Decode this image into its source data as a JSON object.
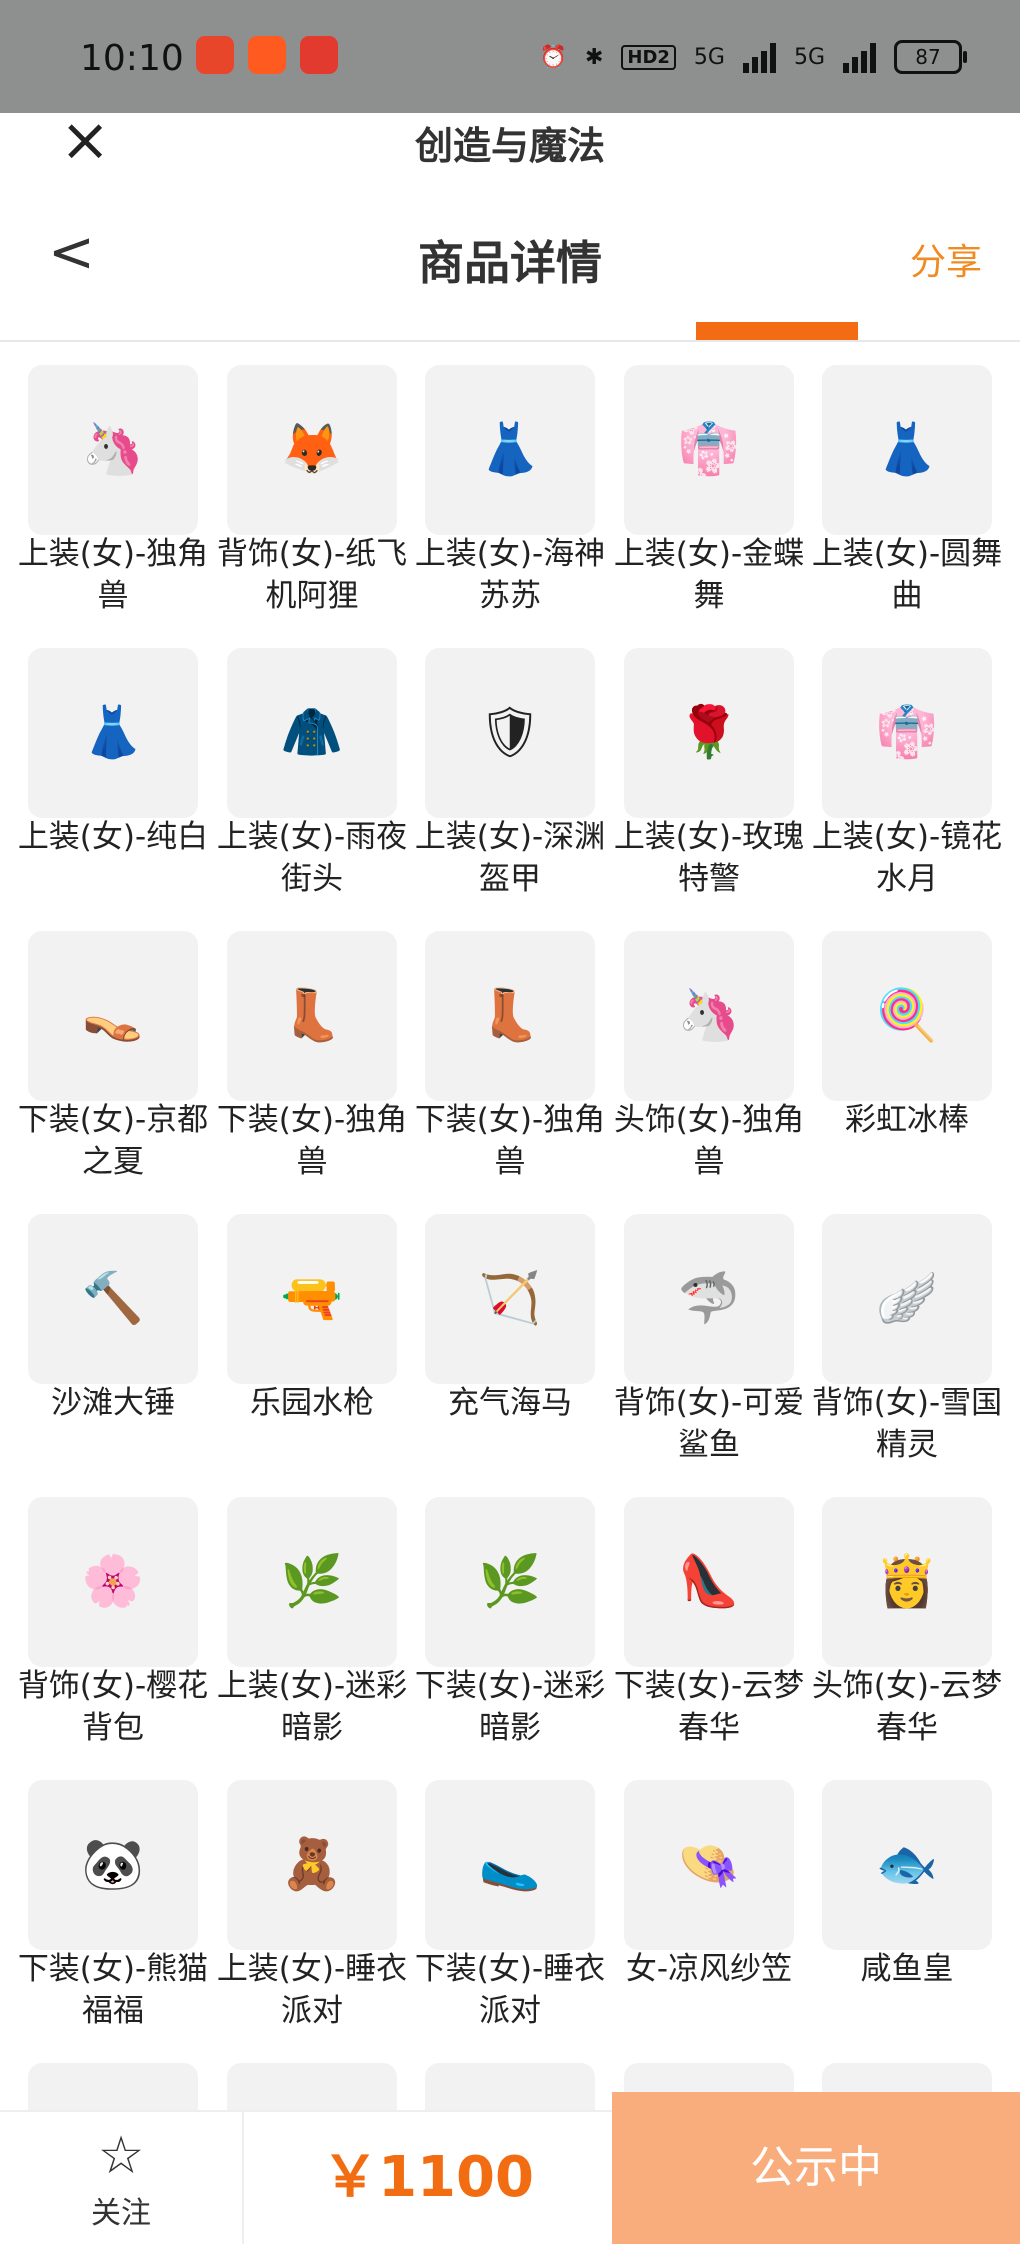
{
  "statusbar": {
    "time": "10:10",
    "network_1": "5G",
    "network_2": "5G",
    "hd": "HD2",
    "battery": "87",
    "app_icons": [
      "weibo-icon",
      "kuaishou-icon",
      "app-icon"
    ]
  },
  "appbar": {
    "title": "创造与魔法"
  },
  "header": {
    "title": "商品详情",
    "share": "分享"
  },
  "items": [
    {
      "label": "上装(女)-独角兽",
      "icon": "🦄"
    },
    {
      "label": "背饰(女)-纸飞机阿狸",
      "icon": "🦊"
    },
    {
      "label": "上装(女)-海神苏苏",
      "icon": "👗"
    },
    {
      "label": "上装(女)-金蝶舞",
      "icon": "👘"
    },
    {
      "label": "上装(女)-圆舞曲",
      "icon": "👗"
    },
    {
      "label": "上装(女)-纯白",
      "icon": "👗"
    },
    {
      "label": "上装(女)-雨夜街头",
      "icon": "🧥"
    },
    {
      "label": "上装(女)-深渊盔甲",
      "icon": "🛡"
    },
    {
      "label": "上装(女)-玫瑰特警",
      "icon": "🌹"
    },
    {
      "label": "上装(女)-镜花水月",
      "icon": "👘"
    },
    {
      "label": "下装(女)-京都之夏",
      "icon": "👡"
    },
    {
      "label": "下装(女)-独角兽",
      "icon": "👢"
    },
    {
      "label": "下装(女)-独角兽",
      "icon": "👢"
    },
    {
      "label": "头饰(女)-独角兽",
      "icon": "🦄"
    },
    {
      "label": "彩虹冰棒",
      "icon": "🍭"
    },
    {
      "label": "沙滩大锤",
      "icon": "🔨"
    },
    {
      "label": "乐园水枪",
      "icon": "🔫"
    },
    {
      "label": "充气海马",
      "icon": "🏹"
    },
    {
      "label": "背饰(女)-可爱鲨鱼",
      "icon": "🦈"
    },
    {
      "label": "背饰(女)-雪国精灵",
      "icon": "🪽"
    },
    {
      "label": "背饰(女)-樱花背包",
      "icon": "🌸"
    },
    {
      "label": "上装(女)-迷彩暗影",
      "icon": "🌿"
    },
    {
      "label": "下装(女)-迷彩暗影",
      "icon": "🌿"
    },
    {
      "label": "下装(女)-云梦春华",
      "icon": "👠"
    },
    {
      "label": "头饰(女)-云梦春华",
      "icon": "👸"
    },
    {
      "label": "下装(女)-熊猫福福",
      "icon": "🐼"
    },
    {
      "label": "上装(女)-睡衣派对",
      "icon": "🧸"
    },
    {
      "label": "下装(女)-睡衣派对",
      "icon": "🥿"
    },
    {
      "label": "女-凉风纱笠",
      "icon": "👒"
    },
    {
      "label": "咸鱼皇",
      "icon": "🐟"
    },
    {
      "label": "",
      "icon": ""
    },
    {
      "label": "",
      "icon": "🎀"
    },
    {
      "label": "",
      "icon": "💧"
    },
    {
      "label": "",
      "icon": ""
    },
    {
      "label": "",
      "icon": ""
    }
  ],
  "bottom": {
    "follow": "关注",
    "price": "￥1100",
    "status": "公示中"
  },
  "colors": {
    "accent": "#f26d12",
    "status_button": "#f9ad7c",
    "share": "#f08a22"
  }
}
